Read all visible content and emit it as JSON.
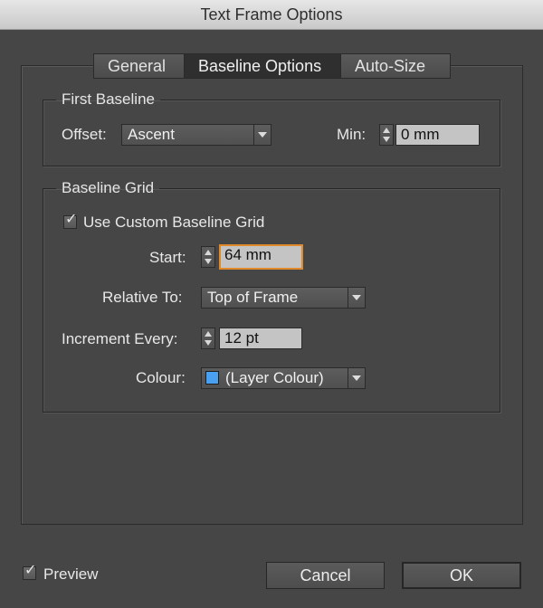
{
  "window": {
    "title": "Text Frame Options"
  },
  "tabs": [
    {
      "label": "General",
      "active": false
    },
    {
      "label": "Baseline Options",
      "active": true
    },
    {
      "label": "Auto-Size",
      "active": false
    }
  ],
  "first_baseline": {
    "legend": "First Baseline",
    "offset_label": "Offset:",
    "offset_value": "Ascent",
    "min_label": "Min:",
    "min_value": "0 mm"
  },
  "baseline_grid": {
    "legend": "Baseline Grid",
    "use_custom_label": "Use Custom Baseline Grid",
    "use_custom_checked": true,
    "start_label": "Start:",
    "start_value": "64 mm",
    "relative_to_label": "Relative To:",
    "relative_to_value": "Top of Frame",
    "increment_label": "Increment Every:",
    "increment_value": "12 pt",
    "colour_label": "Colour:",
    "colour_value": "(Layer Colour)",
    "colour_swatch": "#4aa0f0"
  },
  "footer": {
    "preview_label": "Preview",
    "preview_checked": true,
    "cancel_label": "Cancel",
    "ok_label": "OK"
  },
  "icons": {
    "checkmark": "checkmark-icon",
    "dropdown": "chevron-down-icon",
    "stepper_up": "arrow-up-icon",
    "stepper_down": "arrow-down-icon"
  },
  "colors": {
    "background": "#464646",
    "focus_ring": "#e08a2c",
    "field_bg": "#c4c4c4"
  }
}
